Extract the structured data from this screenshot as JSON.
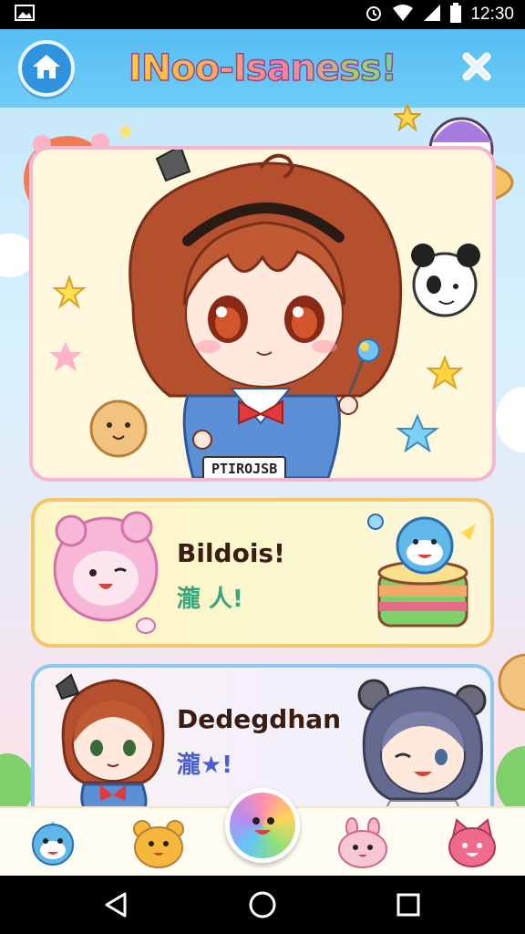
{
  "status_bar": {
    "time": "12:30",
    "icons": [
      "image-icon",
      "alarm-icon",
      "wifi-icon",
      "signal-icon",
      "battery-icon"
    ]
  },
  "header": {
    "title": "INoo-Isaness!",
    "left_icon": "home-icon",
    "right_icon": "close-icon",
    "colors": {
      "bar": "#55bdf2",
      "home_button": "#2f93df"
    }
  },
  "hero": {
    "tag": "PTIROJSB",
    "decorations": [
      "sun-sticker-icon",
      "star-icon",
      "ufo-sticker-icon",
      "panda-sticker-icon",
      "cookie-sticker-icon",
      "lollipop-icon"
    ]
  },
  "cards": [
    {
      "title": "Bildois!",
      "subtitle": "瀧 人!",
      "subtitle_color": "#3aa57a",
      "left_icon": "pink-lion-icon",
      "right_icon": "cake-shark-icon"
    },
    {
      "title": "Dedegdhan",
      "subtitle": "瀧★!",
      "subtitle_color": "#4a5fc7",
      "left_icon": "chibi-girl-icon",
      "right_icon": "bear-girl-icon"
    }
  ],
  "bottom_nav": {
    "items": [
      "shark-icon",
      "bear-icon",
      "rainbow-smile-icon",
      "bunny-icon",
      "pink-cat-icon"
    ]
  },
  "system_nav": {
    "items": [
      "back-icon",
      "home-circle-icon",
      "recents-icon"
    ]
  }
}
